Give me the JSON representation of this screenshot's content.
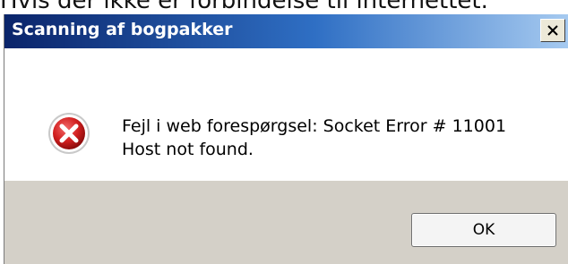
{
  "background": {
    "partial_text": "Hvis der ikke er forbindelse til internettet."
  },
  "dialog": {
    "title": "Scanning af bogpakker",
    "close_label": "X",
    "icon": "error-icon",
    "message_line1": "Fejl i web forespørgsel: Socket Error # 11001",
    "message_line2": "Host not found.",
    "ok_label": "OK"
  },
  "colors": {
    "titlebar_start": "#0a246a",
    "titlebar_end": "#a6caf0",
    "footer": "#d4d0c8",
    "error_red": "#d21f1f"
  }
}
